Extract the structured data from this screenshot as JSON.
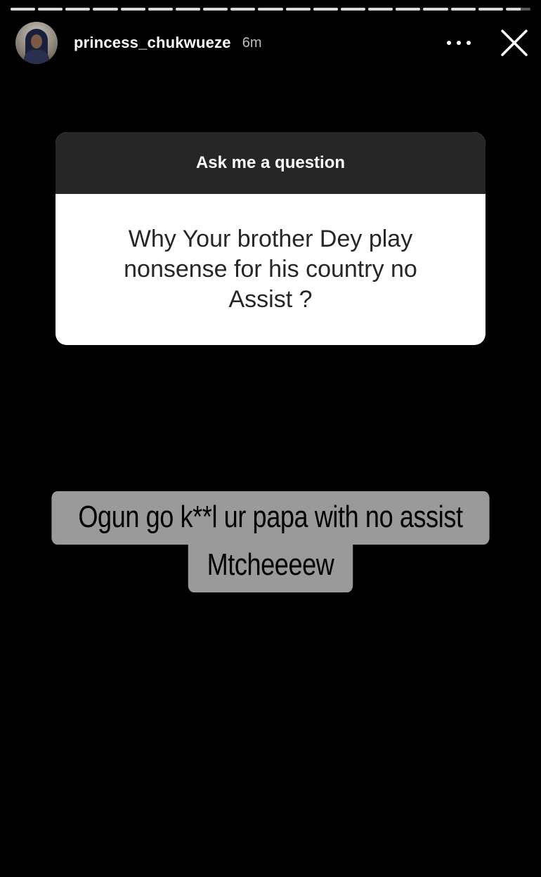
{
  "story": {
    "progress_segments": [
      1,
      1,
      1,
      1,
      1,
      1,
      1,
      1,
      1,
      1,
      1,
      1,
      1,
      1,
      1,
      1,
      1,
      1,
      0.6
    ],
    "username": "princess_chukwueze",
    "time_ago": "6m",
    "more_icon": "more-horizontal-icon",
    "close_icon": "close-icon"
  },
  "question_card": {
    "title": "Ask me a question",
    "question": "Why Your brother Dey play nonsense for his country no Assist ?"
  },
  "caption": {
    "line1": "Ogun go k**l  ur papa with no assist",
    "line2": "Mtcheeeew"
  },
  "colors": {
    "background": "#000000",
    "card_header": "#262626",
    "card_body": "#ffffff",
    "caption_bg": "#9a9a9a"
  }
}
